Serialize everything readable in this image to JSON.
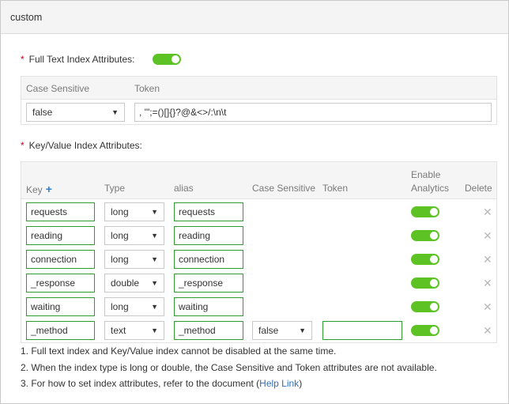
{
  "window": {
    "title": "custom"
  },
  "full_text": {
    "label": "Full Text Index Attributes:",
    "enabled": true,
    "headers": {
      "case_sensitive": "Case Sensitive",
      "token": "Token"
    },
    "case_sensitive_value": "false",
    "token_value": ", '\";=()[]{}?@&<>/:\\n\\t"
  },
  "kv": {
    "label": "Key/Value Index Attributes:",
    "headers": {
      "key": "Key",
      "add_icon": "plus-icon",
      "type": "Type",
      "alias": "alias",
      "case_sensitive": "Case Sensitive",
      "token": "Token",
      "enable_analytics_line1": "Enable",
      "enable_analytics_line2": "Analytics",
      "delete": "Delete"
    },
    "rows": [
      {
        "key": "requests",
        "type": "long",
        "alias": "requests",
        "analytics": true
      },
      {
        "key": "reading",
        "type": "long",
        "alias": "reading",
        "analytics": true
      },
      {
        "key": "connection",
        "type": "long",
        "alias": "connection",
        "analytics": true
      },
      {
        "key": "_response",
        "type": "double",
        "alias": "_response",
        "analytics": true
      },
      {
        "key": "waiting",
        "type": "long",
        "alias": "waiting",
        "analytics": true
      },
      {
        "key": "_method",
        "type": "text",
        "alias": "_method",
        "case_sensitive": "false",
        "token": "",
        "analytics": true
      }
    ]
  },
  "notes": {
    "n1": "1. Full text index and Key/Value index cannot be disabled at the same time.",
    "n2": "2. When the index type is long or double, the Case Sensitive and Token attributes are not available.",
    "n3_prefix": "3. For how to set index attributes, refer to the document (",
    "n3_link": "Help Link",
    "n3_suffix": ")"
  },
  "icons": {
    "select_arrow": "▼",
    "delete": "✕",
    "add": "+"
  },
  "colors": {
    "toggle_on": "#5dc224",
    "link": "#2e6fb7",
    "required": "#d0021b",
    "valid_border": "#2e9e2e"
  }
}
